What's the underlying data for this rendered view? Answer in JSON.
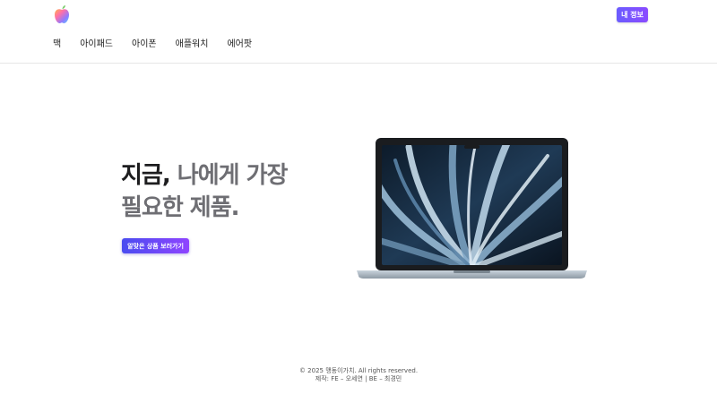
{
  "header": {
    "logo_icon": "apple-logo-icon",
    "my_info_label": "내 정보",
    "nav": [
      "맥",
      "아이패드",
      "아이폰",
      "애플워치",
      "에어팟"
    ]
  },
  "hero": {
    "title_dark_1": "지금,",
    "title_gray_1": " 나에게 가장",
    "title_gray_2": "필요한 제품.",
    "cta_label": "알맞은 상품 보러가기",
    "image": "macbook-air-image"
  },
  "footer": {
    "copyright": "© 2025 맹동이가치. All rights reserved.",
    "credits": "제작: FE – 오세연 | BE – 최경민"
  },
  "colors": {
    "button_gradient_start": "#4a4cf0",
    "button_gradient_end": "#8f44ff",
    "title_dark": "#1d1d1f",
    "title_gray": "#6e6e73"
  }
}
